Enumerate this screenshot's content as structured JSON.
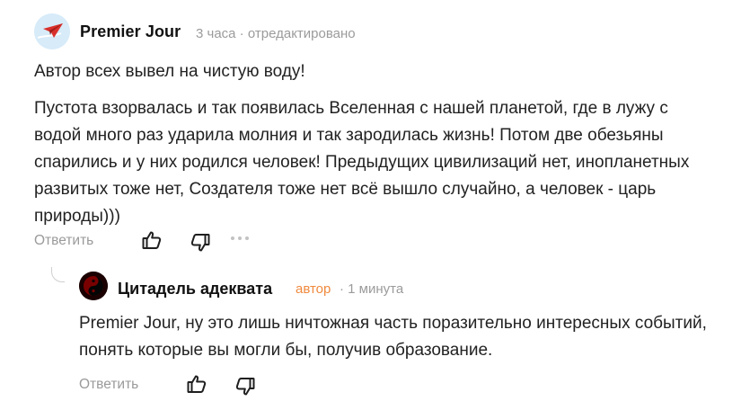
{
  "comment": {
    "author": "Premier Jour",
    "time": "3 часа",
    "edited": "отредактировано",
    "paragraphs": [
      "Автор всех вывел на чистую воду!",
      "Пустота взорвалась и так появилась Вселенная с нашей планетой, где в лужу с водой много раз ударила молния и так зародилась жизнь! Потом две обезьяны спарились и у них родился человек! Предыдущих цивилизаций нет, инопланетных развитых тоже нет, Создателя тоже нет всё вышло случайно, а человек - царь природы)))"
    ],
    "actions": {
      "reply_label": "Ответить",
      "like_icon": "thumbs-up-icon",
      "dislike_icon": "thumbs-down-icon",
      "more_icon": "more-dots-icon"
    }
  },
  "reply": {
    "author": "Цитадель адеквата",
    "author_badge": "автор",
    "time": "1 минута",
    "text": "Premier Jour, ну это лишь ничтожная часть поразительно интересных событий, понять которые вы могли бы, получив образование.",
    "actions": {
      "reply_label": "Ответить",
      "like_icon": "thumbs-up-icon",
      "dislike_icon": "thumbs-down-icon"
    }
  },
  "colors": {
    "author_badge": "#f08a3e",
    "muted": "#9b9b9b",
    "icon": "#1f1f1f"
  }
}
